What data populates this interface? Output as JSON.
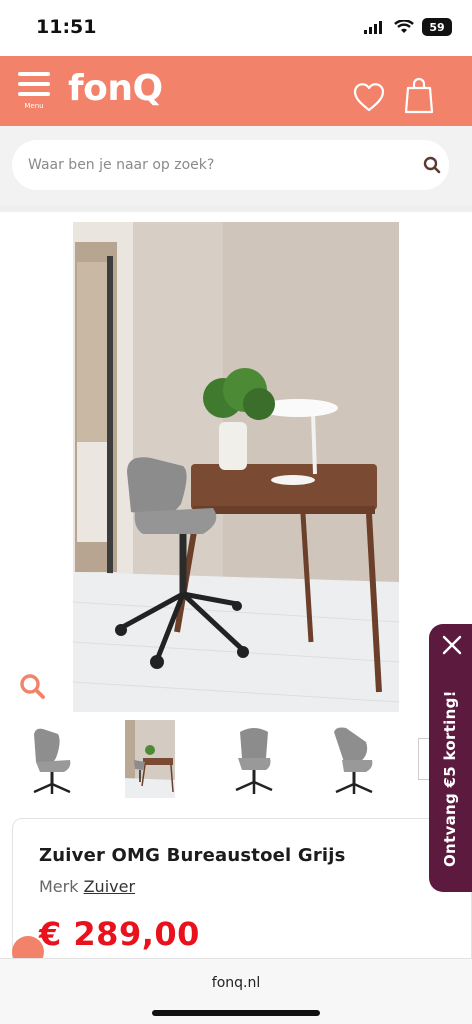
{
  "status_bar": {
    "time": "11:51",
    "battery": "59"
  },
  "header": {
    "menu_label": "Menu",
    "logo": "fonQ",
    "brand_color": "#f2826a"
  },
  "search": {
    "placeholder": "Waar ben je naar op zoek?"
  },
  "gallery": {
    "thumbnails": [
      "chair-front",
      "room-scene",
      "chair-back",
      "chair-side"
    ],
    "active_index": 1
  },
  "product": {
    "title": "Zuiver OMG Bureaustoel Grijs",
    "brand_prefix": "Merk",
    "brand": "Zuiver",
    "price": "€ 289,00",
    "price_color": "#e8111c"
  },
  "promo": {
    "text": "Ontvang €5 korting!",
    "color": "#5c1a3f"
  },
  "browser": {
    "url": "fonq.nl"
  }
}
